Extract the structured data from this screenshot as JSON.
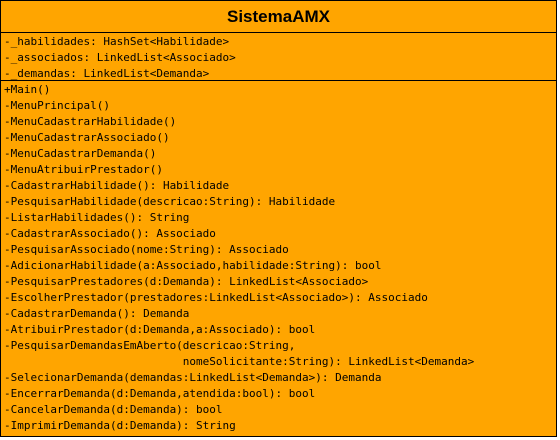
{
  "class_name": "SistemaAMX",
  "attributes": [
    "-_habilidades: HashSet<Habilidade>",
    "-_associados: LinkedList<Associado>",
    "-_demandas: LinkedList<Demanda>"
  ],
  "methods": [
    "+Main()",
    "-MenuPrincipal()",
    "-MenuCadastrarHabilidade()",
    "-MenuCadastrarAssociado()",
    "-MenuCadastrarDemanda()",
    "-MenuAtribuirPrestador()",
    "-CadastrarHabilidade(): Habilidade",
    "-PesquisarHabilidade(descricao:String): Habilidade",
    "-ListarHabilidades(): String",
    "-CadastrarAssociado(): Associado",
    "-PesquisarAssociado(nome:String): Associado",
    "-AdicionarHabilidade(a:Associado,habilidade:String): bool",
    "-PesquisarPrestadores(d:Demanda): LinkedList<Associado>",
    "-EscolherPrestador(prestadores:LinkedList<Associado>): Associado",
    "-CadastrarDemanda(): Demanda",
    "-AtribuirPrestador(d:Demanda,a:Associado): bool",
    "-PesquisarDemandasEmAberto(descricao:String,",
    "                           nomeSolicitante:String): LinkedList<Demanda>",
    "-SelecionarDemanda(demandas:LinkedList<Demanda>): Demanda",
    "-EncerrarDemanda(d:Demanda,atendida:bool): bool",
    "-CancelarDemanda(d:Demanda): bool",
    "-ImprimirDemanda(d:Demanda): String"
  ]
}
